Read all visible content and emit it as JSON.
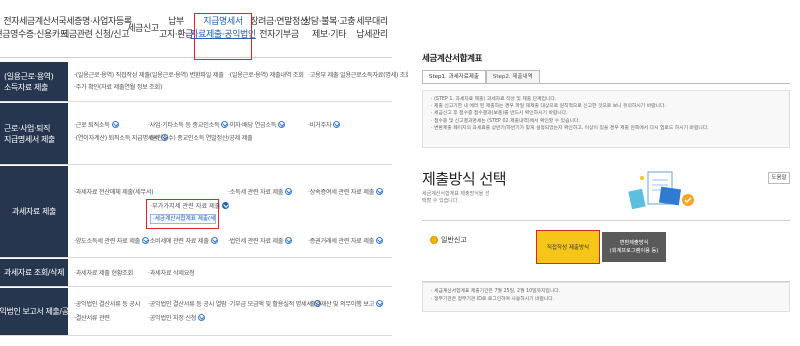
{
  "left": {
    "nav": [
      {
        "line1": "전자세금계산서",
        "line2": "현금영수증·신용카드"
      },
      {
        "line1": "국세증명·사업자등록",
        "line2": "세금관련 신청/신고"
      },
      {
        "line1": "세금신고",
        "line2": ""
      },
      {
        "line1": "납부",
        "line2": "고지·환급"
      },
      {
        "line1": "지급명세서",
        "line2": "자료제출·공익법인"
      },
      {
        "line1": "장려금·연말정산",
        "line2": "전자기부금"
      },
      {
        "line1": "상담·불복·고충",
        "line2": "제보·기타"
      },
      {
        "line1": "세무대리",
        "line2": "납세관리"
      }
    ],
    "sections": {
      "s1": {
        "head1": "(일용근로·용역)",
        "head2": "소득자료 제출",
        "c1a": "·(일용근로·용역) 직접작성 제출",
        "c1b": "·주가 확인(자료 제출연월 정보 조회)",
        "c2": "·(일용근로·용역) 변환파일 제출",
        "c3": "·(일용근로·용역) 제출내역 조회",
        "c4": "·고용부 제출 일용근로소득자료(명세) 조회"
      },
      "s2": {
        "head1": "근로·사업·퇴직",
        "head2": "지급명세서 제출",
        "c1a": "·근로 퇴직소득",
        "c1b": "·(연이자계산) 퇴직소득 지급명세서",
        "c2a": "·사업·기타소득 등 종교인소득",
        "c2b": "·(원천징수) 종교인소득 연말정산/공제 제출",
        "c3": "·이자·배당 연금소득",
        "c4": "·비거주자"
      },
      "s3": {
        "head": "과세자료 제출",
        "c1": "·과세자료 전산매체 제출(세무서)",
        "c2": "·부가가치세 관련 자료 제출",
        "c2sub": "·세금계산서합계표 제출(세무서 등)",
        "c3": "·소득세 관련 자료 제출",
        "c4": "·상속증여세 관련 자료 제출",
        "d1": "·양도소득세 관련 자료 제출",
        "d2": "·소비세에 관련 자료 제출",
        "d3": "·법인세 관련 자료 제출",
        "d4": "·증권거래세 관련 자료 제출"
      },
      "s4": {
        "head": "과세자료 조회/삭제",
        "c1": "·과세자료 제출 현황조회",
        "c2": "·과세자료 삭제요청"
      },
      "s5": {
        "head": "공익법인 보고서 제출/공시",
        "c1a": "·공익법인 결산서류 등 공시",
        "c1b": "·결산서류 관련",
        "c2a": "·공익법인 결산서류 등 공시 열람",
        "c2b": "·공익법인 지정 신청",
        "c3": "·기부금 모금액 및 활용실적 명세서",
        "c4": "·출연재산 및 의무이행 보고"
      }
    }
  },
  "right": {
    "title": "세금계산서합계표",
    "tabs": [
      "Step1. 과세자료제출",
      "Step2. 제출내역"
    ],
    "info": [
      "· (STEP 1. 과세자료 제출) 과세자료 작성 및 제출 단계입니다.",
      "· 제출 신고기한 내 에러 된 제출하는 경우 파일 재제출 대상으로 원칙적으로 신고한 것으로 보니 유의하시기 바랍니다.",
      "· 세금신고 후 접수증 접수결과(보충)를 반드시 확인하시기 바랍니다.",
      "· 접수증 및 신고결과명세는 (STEP 02.제출내역)에서 확인할 수 있습니다.",
      "· 변환제출 페이지의 과세료를 상반기/하반기가 맞게 설정되었는지 확인하고, 이상이 있을 경우 제출 왼쪽에서 다시 업로드 하시기 바랍니다."
    ],
    "big_title": "제출방식 선택",
    "sub_desc": "세금계산서합계표 제출방식을 선택할 수 있습니다.",
    "help_label": "도움말",
    "option_label": "일반신고",
    "btn_direct": "직접작성 제출방식",
    "btn_convert1": "변환제출방식",
    "btn_convert2": "(회계프로그램이용 등)",
    "notes": [
      "· 세금계산서합계표 제출기간은 7월 25일, 2월 10일까지입니다.",
      "· 정부기관은 정부기관 ID로 로그인하여 사용하시기 바랍니다."
    ]
  },
  "colors": {
    "accent_red": "#e0222c",
    "nav_blue": "#1f5fb5",
    "section_navy": "#26364f",
    "button_yellow": "#f5c518"
  }
}
